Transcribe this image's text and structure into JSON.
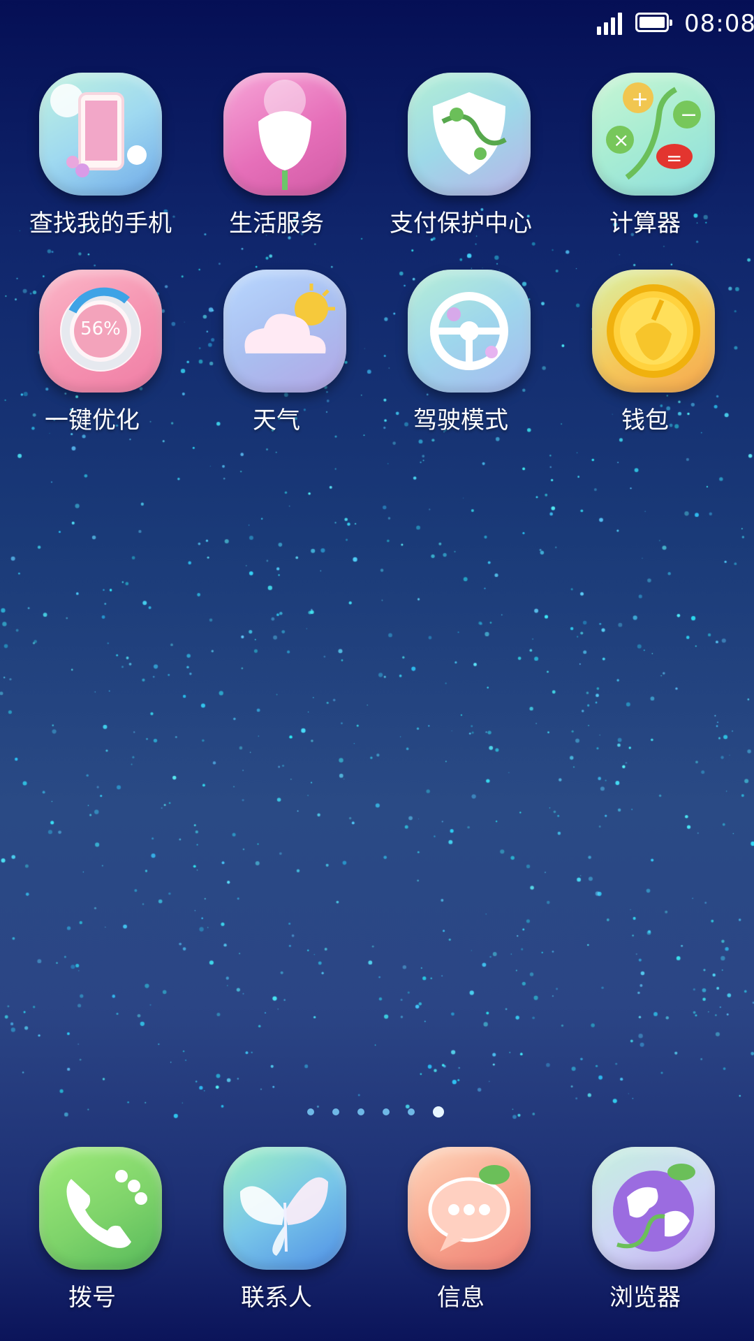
{
  "status_bar": {
    "time": "08:08",
    "signal": "signal-bars-icon",
    "battery": "battery-full-icon"
  },
  "apps": [
    {
      "label": "查找我的手机",
      "icon": "find-phone-icon"
    },
    {
      "label": "生活服务",
      "icon": "life-service-icon"
    },
    {
      "label": "支付保护中心",
      "icon": "payment-shield-icon"
    },
    {
      "label": "计算器",
      "icon": "calculator-icon"
    },
    {
      "label": "一键优化",
      "icon": "optimize-icon",
      "badge": "56%"
    },
    {
      "label": "天气",
      "icon": "weather-icon"
    },
    {
      "label": "驾驶模式",
      "icon": "steering-wheel-icon"
    },
    {
      "label": "钱包",
      "icon": "wallet-coin-icon"
    }
  ],
  "page_indicator": {
    "pages": 6,
    "current": 6
  },
  "dock": [
    {
      "label": "拨号",
      "icon": "phone-icon"
    },
    {
      "label": "联系人",
      "icon": "butterfly-contacts-icon"
    },
    {
      "label": "信息",
      "icon": "message-bubble-icon"
    },
    {
      "label": "浏览器",
      "icon": "globe-browser-icon"
    }
  ]
}
